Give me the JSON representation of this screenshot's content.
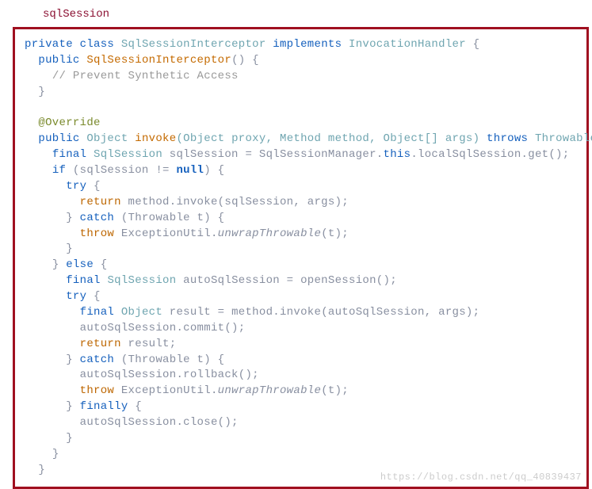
{
  "title": "sqlSession",
  "code": {
    "l1_a": "private",
    "l1_b": "class",
    "l1_c": "SqlSessionInterceptor",
    "l1_d": "implements",
    "l1_e": "InvocationHandler",
    "l1_f": " {",
    "l2_a": "public",
    "l2_b": "SqlSessionInterceptor",
    "l2_c": "() {",
    "l3": "// Prevent Synthetic Access",
    "l4": "}",
    "l6": "@Override",
    "l7_a": "public",
    "l7_b": "Object",
    "l7_c": "invoke",
    "l7_d": "(Object proxy, Method method, Object[] args)",
    "l7_e": "throws",
    "l7_f": "Throwable",
    "l7_g": " {",
    "l8_a": "final",
    "l8_b": "SqlSession",
    "l8_c": " sqlSession = SqlSessionManager.",
    "l8_d": "this",
    "l8_e": ".",
    "l8_f": "localSqlSession",
    "l8_g": ".get();",
    "l9_a": "if",
    "l9_b": " (sqlSession != ",
    "l9_c": "null",
    "l9_d": ") {",
    "l10": "try",
    "l10b": " {",
    "l11_a": "return",
    "l11_b": " method.invoke(sqlSession, args);",
    "l12_a": "} ",
    "l12_b": "catch",
    "l12_c": " (Throwable t) {",
    "l13_a": "throw",
    "l13_b": " ExceptionUtil.",
    "l13_c": "unwrapThrowable",
    "l13_d": "(t);",
    "l14": "}",
    "l15_a": "} ",
    "l15_b": "else",
    "l15_c": " {",
    "l16_a": "final",
    "l16_b": "SqlSession",
    "l16_c": " autoSqlSession = openSession();",
    "l17": "try",
    "l17b": " {",
    "l18_a": "final",
    "l18_b": "Object",
    "l18_c": " result = method.invoke(autoSqlSession, args);",
    "l19": "autoSqlSession.commit();",
    "l20_a": "return",
    "l20_b": " result;",
    "l21_a": "} ",
    "l21_b": "catch",
    "l21_c": " (Throwable t) {",
    "l22": "autoSqlSession.rollback();",
    "l23_a": "throw",
    "l23_b": " ExceptionUtil.",
    "l23_c": "unwrapThrowable",
    "l23_d": "(t);",
    "l24_a": "} ",
    "l24_b": "finally",
    "l24_c": " {",
    "l25": "autoSqlSession.close();",
    "l26": "}",
    "l27": "}",
    "l28": "}"
  },
  "watermark": "https://blog.csdn.net/qq_40839437"
}
